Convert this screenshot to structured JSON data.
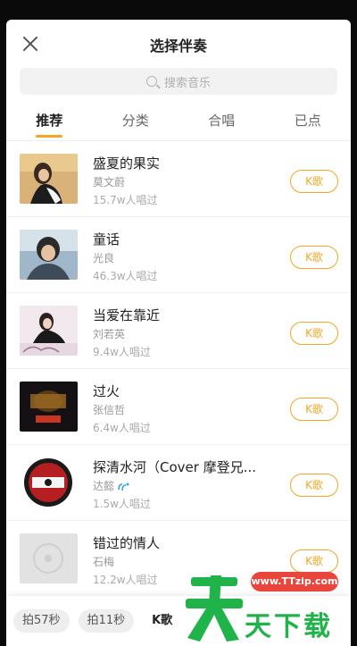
{
  "header": {
    "title": "选择伴奏",
    "close_icon": "close-icon"
  },
  "search": {
    "placeholder": "搜索音乐",
    "icon": "search-icon"
  },
  "tabs": [
    {
      "label": "推荐",
      "active": true
    },
    {
      "label": "分类",
      "active": false
    },
    {
      "label": "合唱",
      "active": false
    },
    {
      "label": "已点",
      "active": false
    }
  ],
  "songs": [
    {
      "title": "盛夏的果实",
      "artist": "莫文蔚",
      "count": "15.7w人唱过",
      "button": "K歌"
    },
    {
      "title": "童话",
      "artist": "光良",
      "count": "46.3w人唱过",
      "button": "K歌"
    },
    {
      "title": "当爱在靠近",
      "artist": "刘若英",
      "count": "9.4w人唱过",
      "button": "K歌"
    },
    {
      "title": "过火",
      "artist": "张信哲",
      "count": "6.4w人唱过",
      "button": "K歌"
    },
    {
      "title": "探清水河（Cover 摩登兄...",
      "artist": "达懿",
      "count": "1.5w人唱过",
      "button": "K歌"
    },
    {
      "title": "错过的情人",
      "artist": "石梅",
      "count": "12.2w人唱过",
      "button": "K歌"
    }
  ],
  "bottom": {
    "chips": [
      "拍57秒",
      "拍11秒",
      "K歌"
    ]
  },
  "watermark": {
    "url": "www.TTzip.com",
    "text": "天下载"
  },
  "colors": {
    "accent": "#f5a623",
    "watermark_green": "#1fb34a",
    "watermark_red": "#e8463c"
  }
}
